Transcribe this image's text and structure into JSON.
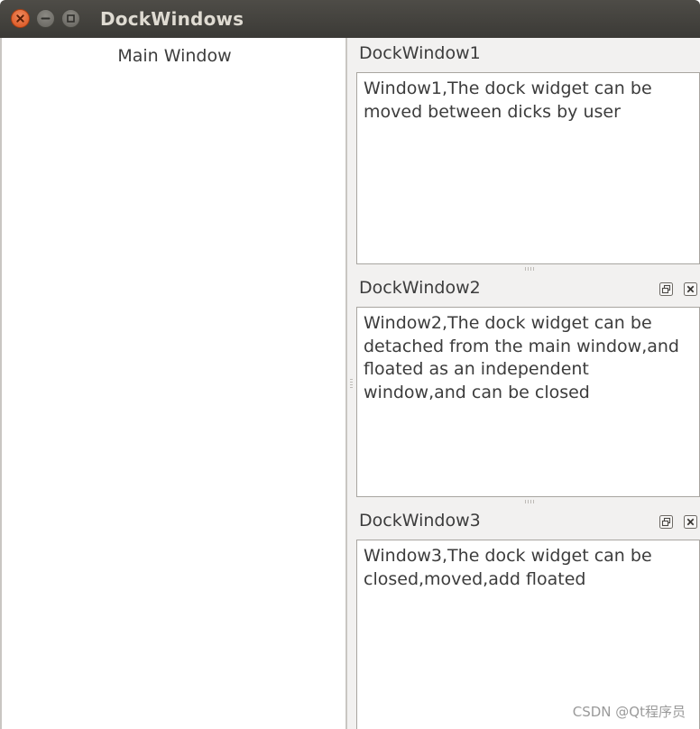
{
  "window": {
    "title": "DockWindows",
    "controls": {
      "close_icon": "close-icon",
      "minimize_icon": "minimize-icon",
      "maximize_icon": "maximize-icon"
    }
  },
  "main": {
    "label": "Main Window"
  },
  "docks": [
    {
      "title": "DockWindow1",
      "text": "Window1,The dock widget can be moved between dicks by user"
    },
    {
      "title": "DockWindow2",
      "text": "Window2,The dock widget can be detached from the main window,and floated as an independent window,and can be closed"
    },
    {
      "title": "DockWindow3",
      "text": "Window3,The dock widget can be closed,moved,add floated"
    }
  ],
  "watermark": "CSDN @Qt程序员",
  "colors": {
    "titlebar": "#3b3a36",
    "close_button": "#e0582a",
    "panel_bg": "#f2f1f0"
  }
}
